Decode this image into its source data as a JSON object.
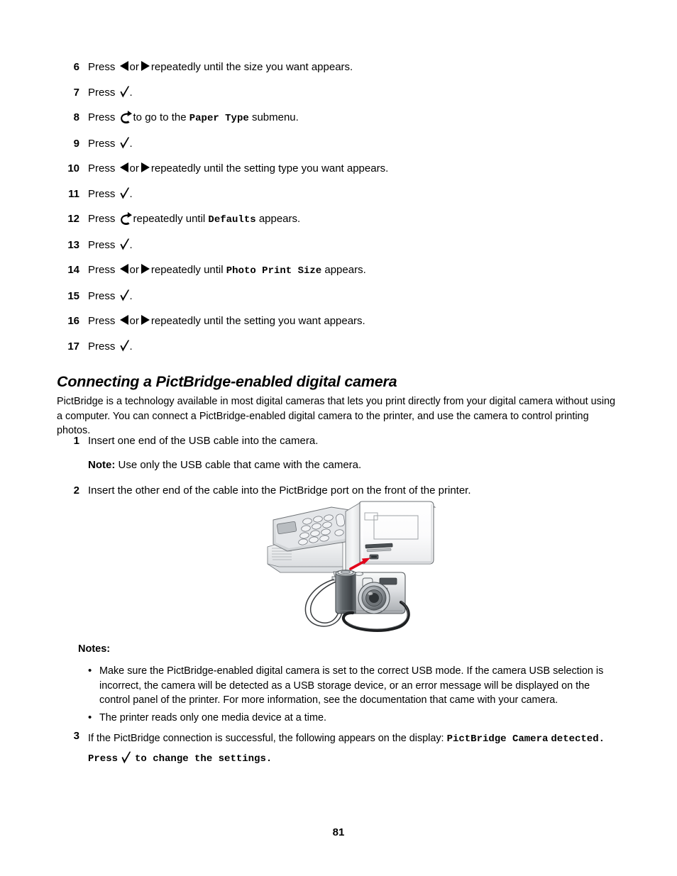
{
  "document": {
    "page_number": "81",
    "heading": "Connecting a PictBridge-enabled digital camera",
    "intro_paragraph": "PictBridge is a technology available in most digital cameras that lets you print directly from your digital camera without using a computer. You can connect a PictBridge-enabled digital camera to the printer, and use the camera to control printing photos."
  },
  "steps_top": [
    {
      "num": "6",
      "pre": "Press ",
      "icons": [
        "left-arrow",
        "or",
        "right-arrow"
      ],
      "post": " repeatedly until the size you want appears."
    },
    {
      "num": "7",
      "pre": "Press ",
      "icons": [
        "check"
      ],
      "post": "."
    },
    {
      "num": "8",
      "pre": "Press ",
      "icons": [
        "back-arrow"
      ],
      "post": " to go to the ",
      "mono": "Paper Type",
      "tail": " submenu."
    },
    {
      "num": "9",
      "pre": "Press ",
      "icons": [
        "check"
      ],
      "post": "."
    },
    {
      "num": "10",
      "pre": "Press ",
      "icons": [
        "left-arrow",
        "or",
        "right-arrow"
      ],
      "post": " repeatedly until the setting type you want appears."
    },
    {
      "num": "11",
      "pre": "Press ",
      "icons": [
        "check"
      ],
      "post": "."
    },
    {
      "num": "12",
      "pre": "Press ",
      "icons": [
        "back-arrow"
      ],
      "post": " repeatedly until ",
      "mono": "Defaults",
      "tail": " appears."
    },
    {
      "num": "13",
      "pre": "Press ",
      "icons": [
        "check"
      ],
      "post": "."
    },
    {
      "num": "14",
      "pre": "Press ",
      "icons": [
        "left-arrow",
        "or",
        "right-arrow"
      ],
      "post": " repeatedly until ",
      "mono": "Photo Print Size",
      "tail": " appears."
    },
    {
      "num": "15",
      "pre": "Press ",
      "icons": [
        "check"
      ],
      "post": "."
    },
    {
      "num": "16",
      "pre": "Press ",
      "icons": [
        "left-arrow",
        "or",
        "right-arrow"
      ],
      "post": " repeatedly until the setting you want appears."
    },
    {
      "num": "17",
      "pre": "Press ",
      "icons": [
        "check"
      ],
      "post": "."
    }
  ],
  "step_labels": {
    "s6_pre": "Press",
    "s6_or": "or",
    "s6_post": "repeatedly until the size you want appears.",
    "s7_pre": "Press",
    "s7_post": ".",
    "s8_pre": "Press",
    "s8_mid": "to go to the",
    "s8_mono": "Paper Type",
    "s8_post": "submenu.",
    "s9_pre": "Press",
    "s9_post": ".",
    "s10_pre": "Press",
    "s10_or": "or",
    "s10_post": "repeatedly until the setting type you want appears.",
    "s11_pre": "Press",
    "s11_post": ".",
    "s12_pre": "Press",
    "s12_mid": "repeatedly until",
    "s12_mono": "Defaults",
    "s12_post": "appears.",
    "s13_pre": "Press",
    "s13_post": ".",
    "s14_pre": "Press",
    "s14_or": "or",
    "s14_mid": "repeatedly until",
    "s14_mono": "Photo Print Size",
    "s14_post": "appears.",
    "s15_pre": "Press",
    "s15_post": ".",
    "s16_pre": "Press",
    "s16_or": "or",
    "s16_post": "repeatedly until the setting you want appears.",
    "s17_pre": "Press",
    "s17_post": "."
  },
  "step_numbers": {
    "n6": "6",
    "n7": "7",
    "n8": "8",
    "n9": "9",
    "n10": "10",
    "n11": "11",
    "n12": "12",
    "n13": "13",
    "n14": "14",
    "n15": "15",
    "n16": "16",
    "n17": "17",
    "p1": "1",
    "p2": "2",
    "p3": "3"
  },
  "pictbridge_steps": {
    "step1_text": "Insert one end of the USB cable into the camera.",
    "note_label": "Note:",
    "note_text": "Use only the USB cable that came with the camera.",
    "step2_text": "Insert the other end of the cable into the PictBridge port on the front of the printer.",
    "step3_lead": "If the PictBridge connection is successful, the following appears on the display:",
    "step3_mono_1": "PictBridge Camera",
    "step3_mono_2a": "detected. Press",
    "step3_mono_2b": "to change the settings."
  },
  "notes": {
    "title": "Notes:",
    "bullet_char": "•",
    "items": [
      "Make sure the PictBridge-enabled digital camera is set to the correct USB mode. If the camera USB selection is incorrect, the camera will be detected as a USB storage device, or an error message will be displayed on the control panel of the printer. For more information, see the documentation that came with your camera.",
      "The printer reads only one media device at a time."
    ]
  },
  "illustration": {
    "alt": "Printer front with PictBridge port and digital camera connected by USB cable",
    "arrow_color": "#e2041b",
    "body_fill": "#fdfdfd",
    "shade_fill": "#d9dbdd",
    "outline_color": "#58595b"
  }
}
